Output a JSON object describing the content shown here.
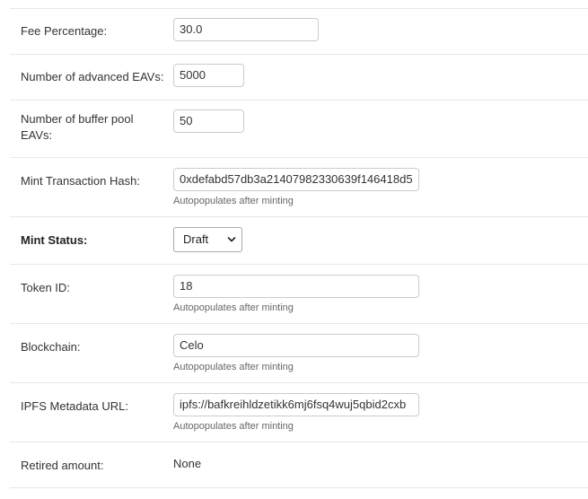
{
  "form": {
    "fee_percentage": {
      "label": "Fee Percentage:",
      "value": "30.0"
    },
    "advanced_eavs": {
      "label": "Number of advanced EAVs:",
      "value": "5000"
    },
    "buffer_pool_eavs": {
      "label": "Number of buffer pool EAVs:",
      "value": "50"
    },
    "mint_tx_hash": {
      "label": "Mint Transaction Hash:",
      "value": "0xdefabd57db3a21407982330639f146418d5",
      "help": "Autopopulates after minting"
    },
    "mint_status": {
      "label": "Mint Status:",
      "selected": "Draft"
    },
    "token_id": {
      "label": "Token ID:",
      "value": "18",
      "help": "Autopopulates after minting"
    },
    "blockchain": {
      "label": "Blockchain:",
      "value": "Celo",
      "help": "Autopopulates after minting"
    },
    "ipfs_url": {
      "label": "IPFS Metadata URL:",
      "value": "ipfs://bafkreihldzetikk6mj6fsq4wuj5qbid2cxb",
      "help": "Autopopulates after minting"
    },
    "retired_amount": {
      "label": "Retired amount:",
      "value": "None"
    }
  },
  "icons": {
    "select_chevron": "chevron-down-icon"
  }
}
